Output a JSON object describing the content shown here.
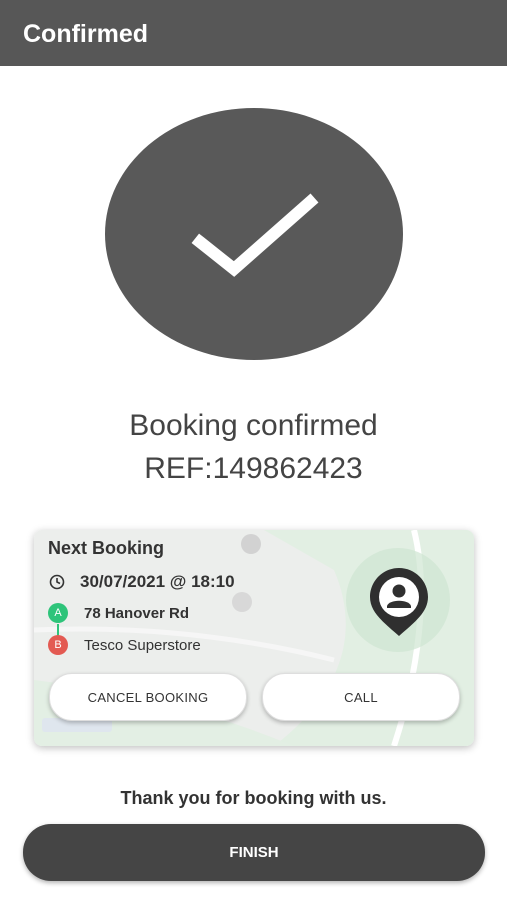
{
  "appbar": {
    "title": "Confirmed"
  },
  "status": {
    "title": "Booking confirmed",
    "reference": "REF:149862423"
  },
  "next_booking": {
    "heading": "Next Booking",
    "datetime": "30/07/2021 @ 18:10",
    "pickup": {
      "marker": "A",
      "address": "78 Hanover Rd"
    },
    "dropoff": {
      "marker": "B",
      "address": "Tesco Superstore"
    },
    "cancel_label": "CANCEL BOOKING",
    "call_label": "CALL"
  },
  "footer": {
    "thanks": "Thank you for booking with us.",
    "finish_label": "FINISH"
  },
  "colors": {
    "appbar": "#575757",
    "marker_a": "#2ec47a",
    "marker_b": "#e35a52",
    "finish": "#454545"
  },
  "icons": [
    "checkmark-icon",
    "clock-icon",
    "driver-pin-icon"
  ]
}
